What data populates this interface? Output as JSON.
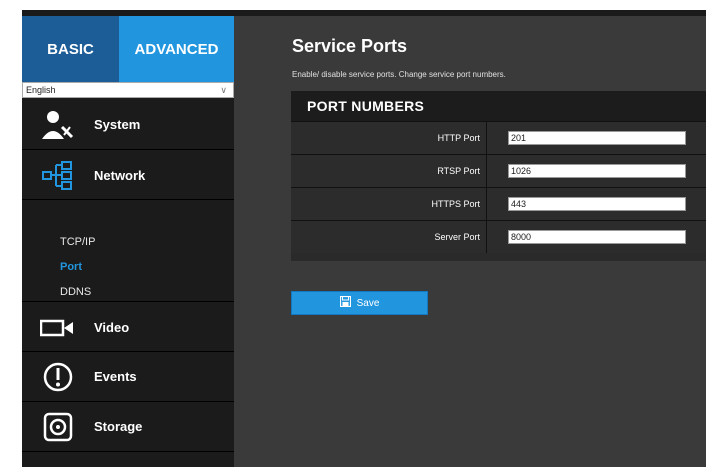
{
  "mode_tabs": {
    "basic": "BASIC",
    "advanced": "ADVANCED"
  },
  "language": {
    "selected": "English"
  },
  "nav": {
    "system": "System",
    "network": "Network",
    "network_sub": [
      "TCP/IP",
      "Port",
      "DDNS"
    ],
    "active_sub": "Port",
    "video": "Video",
    "events": "Events",
    "storage": "Storage"
  },
  "main": {
    "title": "Service Ports",
    "description": "Enable/ disable service ports. Change service port numbers.",
    "panel_title": "PORT NUMBERS",
    "ports": [
      {
        "label": "HTTP Port",
        "value": "201"
      },
      {
        "label": "RTSP Port",
        "value": "1026"
      },
      {
        "label": "HTTPS Port",
        "value": "443"
      },
      {
        "label": "Server Port",
        "value": "8000"
      }
    ],
    "save_label": "Save"
  },
  "colors": {
    "accent": "#2196df",
    "accent_dark": "#1c5d97",
    "sidebar_bg": "#1b1b1b",
    "content_bg": "#3a3a3a"
  },
  "icons": [
    "user-wrench-icon",
    "network-tree-icon",
    "camera-icon",
    "exclamation-icon",
    "disk-icon",
    "save-icon",
    "chevron-down-icon"
  ]
}
